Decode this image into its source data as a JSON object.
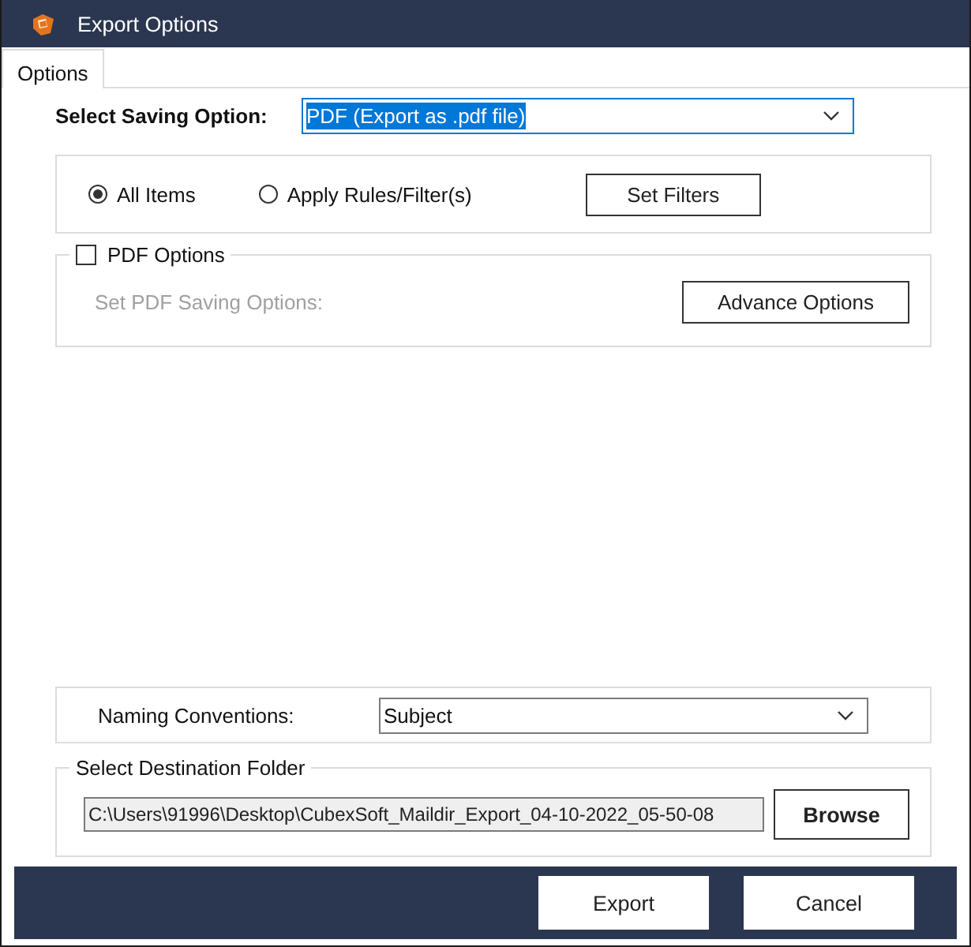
{
  "window": {
    "title": "Export Options"
  },
  "tabs": [
    {
      "label": "Options",
      "selected": true
    }
  ],
  "saving_option": {
    "label": "Select Saving Option:",
    "value": "PDF (Export as .pdf file)"
  },
  "scope": {
    "options": [
      {
        "label": "All Items",
        "selected": true
      },
      {
        "label": "Apply Rules/Filter(s)",
        "selected": false
      }
    ],
    "button": "Set Filters"
  },
  "pdf_options": {
    "label": "PDF Options",
    "checked": false,
    "hint": "Set PDF Saving Options:",
    "button": "Advance Options"
  },
  "naming": {
    "label": "Naming Conventions:",
    "value": "Subject"
  },
  "destination": {
    "legend": "Select Destination Folder",
    "path": "C:\\Users\\91996\\Desktop\\CubexSoft_Maildir_Export_04-10-2022_05-50-08",
    "button": "Browse"
  },
  "buttons": [
    "Export",
    "Cancel"
  ]
}
